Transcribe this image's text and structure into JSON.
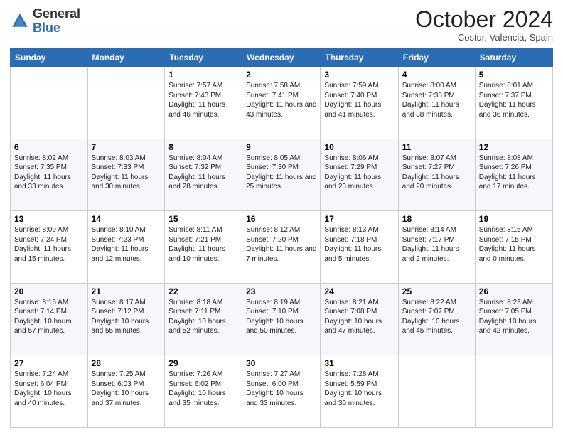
{
  "header": {
    "logo": {
      "general": "General",
      "blue": "Blue"
    },
    "title": "October 2024",
    "location": "Costur, Valencia, Spain"
  },
  "days_of_week": [
    "Sunday",
    "Monday",
    "Tuesday",
    "Wednesday",
    "Thursday",
    "Friday",
    "Saturday"
  ],
  "weeks": [
    [
      {
        "day": "",
        "info": ""
      },
      {
        "day": "",
        "info": ""
      },
      {
        "day": "1",
        "info": "Sunrise: 7:57 AM\nSunset: 7:43 PM\nDaylight: 11 hours and 46 minutes."
      },
      {
        "day": "2",
        "info": "Sunrise: 7:58 AM\nSunset: 7:41 PM\nDaylight: 11 hours and 43 minutes."
      },
      {
        "day": "3",
        "info": "Sunrise: 7:59 AM\nSunset: 7:40 PM\nDaylight: 11 hours and 41 minutes."
      },
      {
        "day": "4",
        "info": "Sunrise: 8:00 AM\nSunset: 7:38 PM\nDaylight: 11 hours and 38 minutes."
      },
      {
        "day": "5",
        "info": "Sunrise: 8:01 AM\nSunset: 7:37 PM\nDaylight: 11 hours and 36 minutes."
      }
    ],
    [
      {
        "day": "6",
        "info": "Sunrise: 8:02 AM\nSunset: 7:35 PM\nDaylight: 11 hours and 33 minutes."
      },
      {
        "day": "7",
        "info": "Sunrise: 8:03 AM\nSunset: 7:33 PM\nDaylight: 11 hours and 30 minutes."
      },
      {
        "day": "8",
        "info": "Sunrise: 8:04 AM\nSunset: 7:32 PM\nDaylight: 11 hours and 28 minutes."
      },
      {
        "day": "9",
        "info": "Sunrise: 8:05 AM\nSunset: 7:30 PM\nDaylight: 11 hours and 25 minutes."
      },
      {
        "day": "10",
        "info": "Sunrise: 8:06 AM\nSunset: 7:29 PM\nDaylight: 11 hours and 23 minutes."
      },
      {
        "day": "11",
        "info": "Sunrise: 8:07 AM\nSunset: 7:27 PM\nDaylight: 11 hours and 20 minutes."
      },
      {
        "day": "12",
        "info": "Sunrise: 8:08 AM\nSunset: 7:26 PM\nDaylight: 11 hours and 17 minutes."
      }
    ],
    [
      {
        "day": "13",
        "info": "Sunrise: 8:09 AM\nSunset: 7:24 PM\nDaylight: 11 hours and 15 minutes."
      },
      {
        "day": "14",
        "info": "Sunrise: 8:10 AM\nSunset: 7:23 PM\nDaylight: 11 hours and 12 minutes."
      },
      {
        "day": "15",
        "info": "Sunrise: 8:11 AM\nSunset: 7:21 PM\nDaylight: 11 hours and 10 minutes."
      },
      {
        "day": "16",
        "info": "Sunrise: 8:12 AM\nSunset: 7:20 PM\nDaylight: 11 hours and 7 minutes."
      },
      {
        "day": "17",
        "info": "Sunrise: 8:13 AM\nSunset: 7:18 PM\nDaylight: 11 hours and 5 minutes."
      },
      {
        "day": "18",
        "info": "Sunrise: 8:14 AM\nSunset: 7:17 PM\nDaylight: 11 hours and 2 minutes."
      },
      {
        "day": "19",
        "info": "Sunrise: 8:15 AM\nSunset: 7:15 PM\nDaylight: 11 hours and 0 minutes."
      }
    ],
    [
      {
        "day": "20",
        "info": "Sunrise: 8:16 AM\nSunset: 7:14 PM\nDaylight: 10 hours and 57 minutes."
      },
      {
        "day": "21",
        "info": "Sunrise: 8:17 AM\nSunset: 7:12 PM\nDaylight: 10 hours and 55 minutes."
      },
      {
        "day": "22",
        "info": "Sunrise: 8:18 AM\nSunset: 7:11 PM\nDaylight: 10 hours and 52 minutes."
      },
      {
        "day": "23",
        "info": "Sunrise: 8:19 AM\nSunset: 7:10 PM\nDaylight: 10 hours and 50 minutes."
      },
      {
        "day": "24",
        "info": "Sunrise: 8:21 AM\nSunset: 7:08 PM\nDaylight: 10 hours and 47 minutes."
      },
      {
        "day": "25",
        "info": "Sunrise: 8:22 AM\nSunset: 7:07 PM\nDaylight: 10 hours and 45 minutes."
      },
      {
        "day": "26",
        "info": "Sunrise: 8:23 AM\nSunset: 7:05 PM\nDaylight: 10 hours and 42 minutes."
      }
    ],
    [
      {
        "day": "27",
        "info": "Sunrise: 7:24 AM\nSunset: 6:04 PM\nDaylight: 10 hours and 40 minutes."
      },
      {
        "day": "28",
        "info": "Sunrise: 7:25 AM\nSunset: 6:03 PM\nDaylight: 10 hours and 37 minutes."
      },
      {
        "day": "29",
        "info": "Sunrise: 7:26 AM\nSunset: 6:02 PM\nDaylight: 10 hours and 35 minutes."
      },
      {
        "day": "30",
        "info": "Sunrise: 7:27 AM\nSunset: 6:00 PM\nDaylight: 10 hours and 33 minutes."
      },
      {
        "day": "31",
        "info": "Sunrise: 7:28 AM\nSunset: 5:59 PM\nDaylight: 10 hours and 30 minutes."
      },
      {
        "day": "",
        "info": ""
      },
      {
        "day": "",
        "info": ""
      }
    ]
  ]
}
